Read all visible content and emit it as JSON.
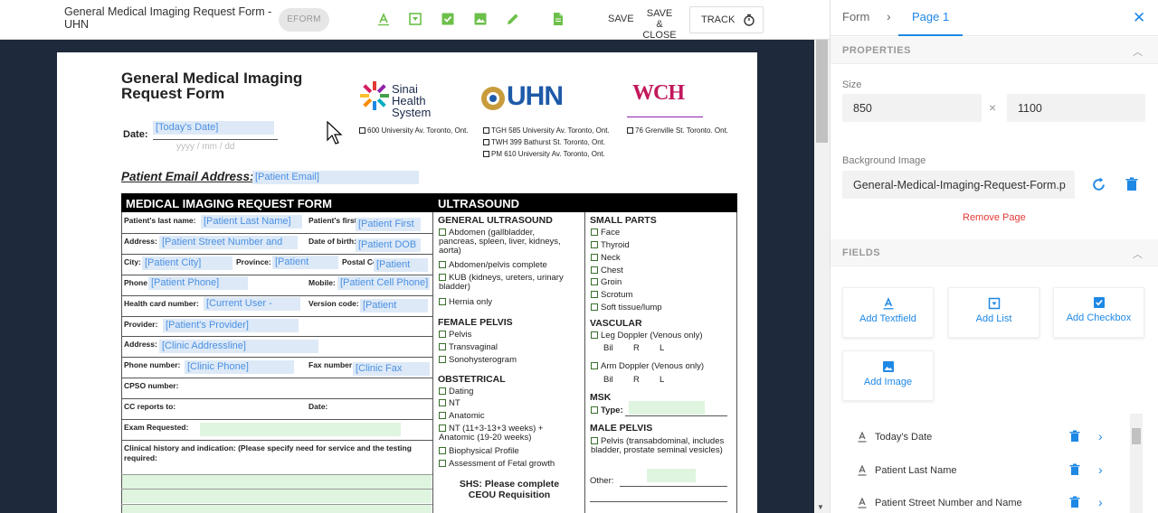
{
  "topbar": {
    "title": "General Medical Imaging Request Form - UHN",
    "eform_badge": "EFORM",
    "save_label": "SAVE",
    "save_close_label": "SAVE & CLOSE",
    "track_label": "TRACK",
    "tools": [
      "textfield-tool-icon",
      "list-tool-icon",
      "checkbox-tool-icon",
      "image-tool-icon",
      "pencil-tool-icon",
      "document-tool-icon"
    ]
  },
  "panel": {
    "breadcrumb_form": "Form",
    "breadcrumb_page": "Page 1",
    "properties_heading": "PROPERTIES",
    "size_label": "Size",
    "width": "850",
    "height": "1100",
    "times": "×",
    "background_label": "Background Image",
    "background_file": "General-Medical-Imaging-Request-Form.p",
    "remove_page": "Remove Page",
    "fields_heading": "FIELDS",
    "add_textfield": "Add Textfield",
    "add_list": "Add List",
    "add_checkbox": "Add Checkbox",
    "add_image": "Add Image",
    "fields": [
      {
        "name": "Today's Date"
      },
      {
        "name": "Patient Last Name"
      },
      {
        "name": "Patient Street Number and Name"
      }
    ],
    "accent": "#1e88e5",
    "danger": "#e53935"
  },
  "paper": {
    "form_title": "General Medical Imaging Request Form",
    "date_label": "Date:",
    "date_field": "[Today's Date]",
    "date_placeholder": "yyyy / mm / dd",
    "sinai_text": "Sinai Health System",
    "uhn_text": "UHN",
    "wch_text": "WCH",
    "addr_sinai": "600 University Av. Toronto, Ont.",
    "addr_tgh": "TGH 585 University Av. Toronto, Ont.",
    "addr_twh": "TWH 399 Bathurst St. Toronto, Ont.",
    "addr_pm": "PM 610 University Av. Toronto, Ont.",
    "addr_wch": "76 Grenville St. Toronto. Ont.",
    "email_label": "Patient Email Address:",
    "email_field": "[Patient Email]",
    "bar_left": "MEDICAL IMAGING REQUEST FORM",
    "bar_right": "ULTRASOUND",
    "labels": {
      "last_name": "Patient's last name:",
      "first_name": "Patient's first name:",
      "address": "Address:",
      "dob": "Date of birth:",
      "city": "City:",
      "province": "Province:",
      "postal": "Postal Code:",
      "phone": "Phone",
      "mobile": "Mobile:",
      "hc": "Health card number:",
      "version": "Version code:",
      "provider": "Provider:",
      "prov_address": "Address:",
      "phone_number": "Phone number:",
      "fax": "Fax number:",
      "cpso": "CPSO number:",
      "cc": "CC reports to:",
      "date": "Date:",
      "exam": "Exam Requested:",
      "clinical": "Clinical history and indication: (Please specify need for service and the testing required:"
    },
    "fields": {
      "last_name": "[Patient Last Name]",
      "first_name": "[Patient First",
      "street": "[Patient Street Number and",
      "dob": "[Patient DOB",
      "city": "[Patient City]",
      "province": "[Patient",
      "postal": "[Patient",
      "phone": "[Patient Phone]",
      "cell": "[Patient Cell Phone]",
      "hc": "[Current User -",
      "version": "[Patient",
      "provider": "[Patient's Provider]",
      "clinic_addr": "[Clinic Addressline]",
      "clinic_phone": "[Clinic Phone]",
      "clinic_fax": "[Clinic Fax"
    },
    "us": {
      "general": "GENERAL ULTRASOUND",
      "abdomen": "Abdomen (gallbladder, pancreas, spleen, liver, kidneys, aorta)",
      "abd_pelvis": "Abdomen/pelvis complete",
      "kub": "KUB (kidneys, ureters, urinary bladder)",
      "hernia": "Hernia only",
      "female": "FEMALE PELVIS",
      "pelvis": "Pelvis",
      "transvaginal": "Transvaginal",
      "sono": "Sonohysterogram",
      "obstetrical": "OBSTETRICAL",
      "dating": "Dating",
      "nt": "NT",
      "anatomic": "Anatomic",
      "nt_anat": "NT (11+3-13+3 weeks) + Anatomic (19-20 weeks)",
      "bio": "Biophysical Profile",
      "fetal": "Assessment of Fetal growth",
      "shs": "SHS: Please complete CEOU Requisition",
      "small": "SMALL PARTS",
      "face": "Face",
      "thyroid": "Thyroid",
      "neck": "Neck",
      "chest": "Chest",
      "groin": "Groin",
      "scrotum": "Scrotum",
      "soft": "Soft tissue/lump",
      "vascular": "VASCULAR",
      "leg": "Leg Doppler (Venous only)",
      "arm": "Arm Doppler (Venous only)",
      "bil": "Bil",
      "r": "R",
      "l": "L",
      "msk": "MSK",
      "type": "Type:",
      "male": "MALE PELVIS",
      "male_pelvis": "Pelvis (transabdominal, includes bladder, prostate seminal vesicles)",
      "other": "Other:"
    }
  }
}
